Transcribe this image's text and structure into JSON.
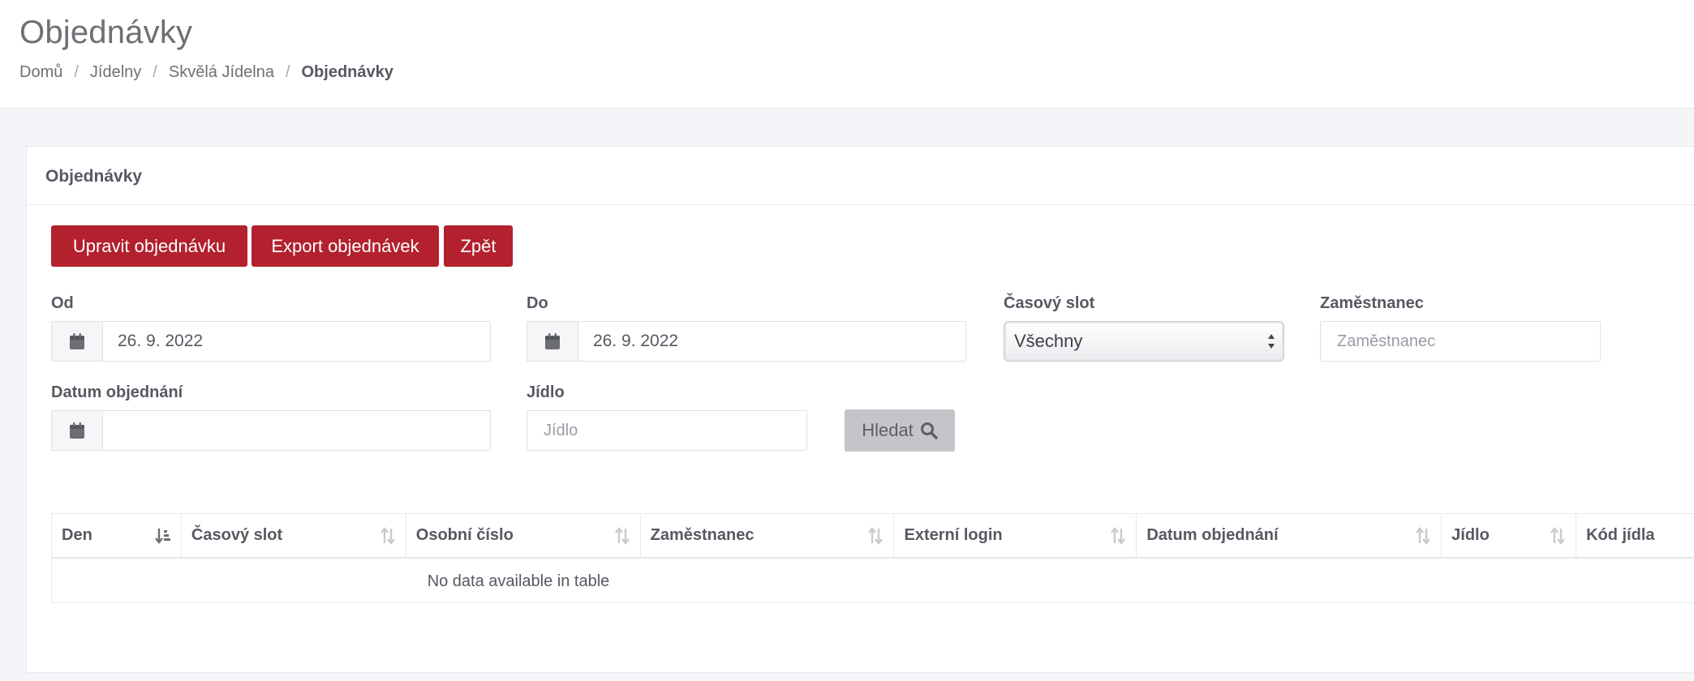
{
  "header": {
    "title": "Objednávky",
    "breadcrumb": [
      "Domů",
      "Jídelny",
      "Skvělá Jídelna",
      "Objednávky"
    ]
  },
  "card": {
    "title": "Objednávky"
  },
  "buttons": {
    "edit": "Upravit objednávku",
    "export": "Export objednávek",
    "back": "Zpět"
  },
  "filters": {
    "from_label": "Od",
    "from_value": "26. 9. 2022",
    "to_label": "Do",
    "to_value": "26. 9. 2022",
    "slot_label": "Časový slot",
    "slot_value": "Všechny",
    "employee_label": "Zaměstnanec",
    "employee_placeholder": "Zaměstnanec",
    "order_date_label": "Datum objednání",
    "order_date_value": "",
    "meal_label": "Jídlo",
    "meal_placeholder": "Jídlo",
    "search_label": "Hledat"
  },
  "table": {
    "columns": [
      "Den",
      "Časový slot",
      "Osobní číslo",
      "Zaměstnanec",
      "Externí login",
      "Datum objednání",
      "Jídlo",
      "Kód jídla"
    ],
    "empty_message": "No data available in table"
  },
  "colors": {
    "primary": "#b2212d",
    "disabled_button": "#c4c5c9",
    "background": "#f4f5f8"
  },
  "icons": {
    "date_addon": "calendar-icon",
    "search": "search-icon",
    "sort_active": "sort-amount-down-icon",
    "sort": "sort-icon",
    "select_arrows": "select-arrows-icon"
  }
}
